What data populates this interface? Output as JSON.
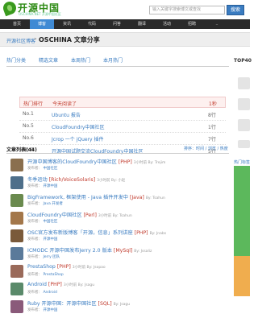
{
  "header": {
    "logo_text": "开源中国",
    "logo_sub": "OSCHINA.NET 开源中国社区",
    "search_placeholder": "输入关键字搜索博文或查找",
    "search_button": "搜索"
  },
  "topnav": {
    "items": [
      {
        "label": "首页",
        "active": false
      },
      {
        "label": "博客",
        "active": true
      },
      {
        "label": "资讯",
        "active": false
      },
      {
        "label": "代码",
        "active": false
      },
      {
        "label": "问答",
        "active": false
      },
      {
        "label": "翻译",
        "active": false
      },
      {
        "label": "活动",
        "active": false
      },
      {
        "label": "招聘",
        "active": false
      },
      {
        "label": "..",
        "active": false
      }
    ]
  },
  "breadcrumb": {
    "link": "开源社区博客",
    "sep": "»",
    "title": "OSCHINA 文章分享"
  },
  "tabs": [
    {
      "label": "热门分类",
      "active": false
    },
    {
      "label": "精选文章",
      "active": false
    },
    {
      "label": "本周热门",
      "active": false
    },
    {
      "label": "本月热门",
      "active": false
    }
  ],
  "right_panel": {
    "top40_label": "TOP40",
    "hot_label": "热门文章",
    "hot_title": "热门标签"
  },
  "hot_table": {
    "header": {
      "rank": "热门排行",
      "title": "今天阅读了",
      "count": "1秒"
    },
    "rows": [
      {
        "rank": "No.1",
        "title": "Ubuntu 报告",
        "count": "8行"
      },
      {
        "rank": "No.5",
        "title": "CloudFoundry中国社区",
        "count": "1行"
      },
      {
        "rank": "No.6",
        "title": "Jcrop 一个 jQuery 插件",
        "count": "7行"
      },
      {
        "rank": "No.5",
        "title": "开源中国试题交流CloudFoundry中国社区",
        "count": "5行"
      }
    ]
  },
  "article_list": {
    "title": "文章列表(44)",
    "sort": "排序：时间 / 浏览 / 热度",
    "items": [
      {
        "title": "开源中国博客的CloudFoundry中国社区",
        "tag": "[PHP]",
        "meta": "3小时前 By: Trejim",
        "sub_label": "发布者：",
        "poster": "中国社区",
        "avatar_color": "#8a6f4e"
      },
      {
        "title": "冬季运动",
        "tag": "[Rich/VoiceSolaris]",
        "meta": "3小时前 By: 小赵",
        "sub_label": "发布者：",
        "poster": "开源中国",
        "avatar_color": "#4e6f8a"
      },
      {
        "title": "BigFramework, 框架使用 - Java 插件开发中",
        "tag": "[Java]",
        "meta": "By: Tsahun",
        "sub_label": "发布者：",
        "poster": "Java 开发者",
        "avatar_color": "#6a8a4e"
      },
      {
        "title": "CloudFoundry中国社区",
        "tag": "[Perl]",
        "meta": "3小时前 By: Tsahun",
        "sub_label": "发布者：",
        "poster": "中国社区",
        "avatar_color": "#a3774a"
      },
      {
        "title": "OSC官方发布新版博客「开源，信息」系列讲座",
        "tag": "[PHP]",
        "meta": "By: Jnabs",
        "sub_label": "发布者：",
        "poster": "开源中国",
        "avatar_color": "#7a5a3a"
      },
      {
        "title": "ICMODC 开源中国发布Jerry 2.0 版本",
        "tag": "[MySql]",
        "meta": "By: Jssaliz",
        "sub_label": "发布者：",
        "poster": "Jerry 团队",
        "avatar_color": "#5a7a9a"
      },
      {
        "title": "PrestaShop",
        "tag": "[PHP]",
        "meta": "3小时前 By: Jsopao",
        "sub_label": "发布者：",
        "poster": "PrestaShop",
        "avatar_color": "#9a6a5a"
      },
      {
        "title": "Android",
        "tag": "[PHP]",
        "meta": "3小时前 By: Jsagu",
        "sub_label": "发布者：",
        "poster": "Android",
        "avatar_color": "#5a8a6a"
      },
      {
        "title": "Ruby 开源中国：开源中国社区",
        "tag": "[SQL]",
        "meta": "By: Jsagu",
        "sub_label": "发布者：",
        "poster": "开源中国",
        "avatar_color": "#8a5a7a"
      }
    ]
  },
  "colors": {
    "accent": "#3f8ad4",
    "brand": "#2e8b15",
    "nav_bg": "#2a2a2a",
    "link": "#3a7cc1",
    "tag": "#c0392b"
  }
}
